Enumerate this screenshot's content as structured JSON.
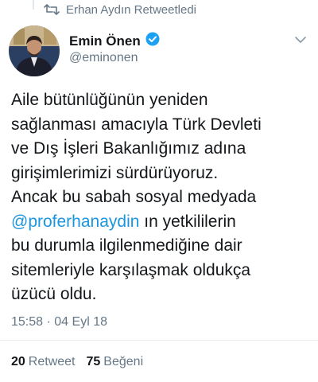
{
  "retweet": {
    "icon": "retweet-icon",
    "text": "Erhan Aydın Retweetledi"
  },
  "author": {
    "name": "Emin Önen",
    "handle": "@eminonen",
    "verified": true,
    "verified_color": "#1da1f2"
  },
  "tweet": {
    "lines": [
      "Aile bütünlüğünün yeniden",
      "sağlanması amacıyla Türk Devleti",
      "ve Dış İşleri Bakanlığımız adına",
      "girişimlerimizi sürdürüyoruz.",
      "Ancak bu sabah sosyal medyada",
      "ın yetkililerin",
      "bu durumla ilgilenmediğine dair",
      "sitemleriyle karşılaşmak oldukça",
      "üzücü oldu."
    ],
    "mention": "@proferhanaydin"
  },
  "meta": {
    "time": "15:58",
    "separator": "·",
    "date": "04 Eyl 18"
  },
  "stats": {
    "retweet_count": "20",
    "retweet_label": "Retweet",
    "like_count": "75",
    "like_label": "Beğeni"
  },
  "colors": {
    "text": "#14171a",
    "muted": "#657786",
    "link": "#1b95e0"
  }
}
